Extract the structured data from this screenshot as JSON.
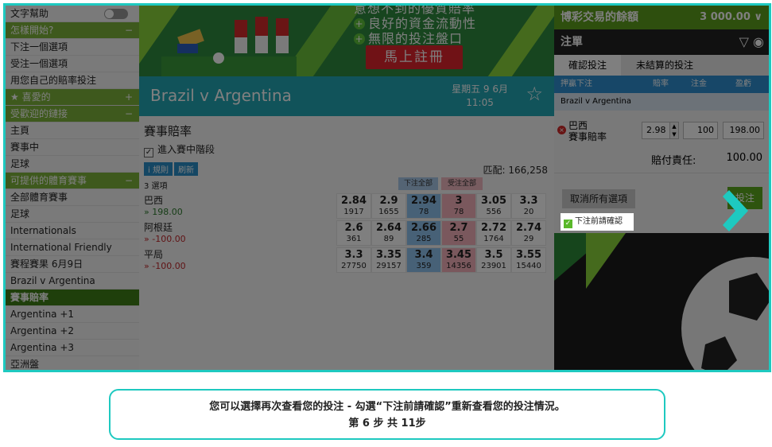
{
  "sidebar": {
    "items": [
      {
        "label": "文字幫助",
        "kind": "toggle"
      },
      {
        "label": "怎樣開始?",
        "kind": "head",
        "sign": "−"
      },
      {
        "label": "下注一個選項",
        "kind": "item"
      },
      {
        "label": "受注一個選項",
        "kind": "item"
      },
      {
        "label": "用您自己的賠率投注",
        "kind": "item"
      },
      {
        "label": "喜愛的",
        "kind": "head",
        "sign": "+",
        "star": true
      },
      {
        "label": "受歡迎的鏈接",
        "kind": "head",
        "sign": "−"
      },
      {
        "label": "主頁",
        "kind": "item"
      },
      {
        "label": "賽事中",
        "kind": "item"
      },
      {
        "label": "足球",
        "kind": "item"
      },
      {
        "label": "可提供的體育賽事",
        "kind": "head",
        "sign": "−"
      },
      {
        "label": "全部體育賽事",
        "kind": "item"
      },
      {
        "label": "足球",
        "kind": "item"
      },
      {
        "label": "Internationals",
        "kind": "item"
      },
      {
        "label": "International Friendly",
        "kind": "item"
      },
      {
        "label": "賽程賽果 6月9日",
        "kind": "item"
      },
      {
        "label": "Brazil v Argentina",
        "kind": "item"
      },
      {
        "label": "賽事賠率",
        "kind": "active"
      },
      {
        "label": "Argentina +1",
        "kind": "item"
      },
      {
        "label": "Argentina +2",
        "kind": "item"
      },
      {
        "label": "Argentina +3",
        "kind": "item"
      },
      {
        "label": "亞洲盤",
        "kind": "item"
      }
    ]
  },
  "banner": {
    "line0": "意想不到的優質賠率",
    "line1": "良好的資金流動性",
    "line2": "無限的投注盤口",
    "register": "馬上註冊"
  },
  "match": {
    "title": "Brazil v Argentina",
    "date": "星期五 9 6月",
    "time": "11:05"
  },
  "market": {
    "title": "賽事賠率",
    "inplay": "進入賽中階段",
    "rules": "規則",
    "refresh": "刷新",
    "matched": "匹配: 166,258",
    "selections": "3 選項",
    "back_all": "下注全部",
    "lay_all": "受注全部",
    "runners": [
      {
        "name": "巴西",
        "pl": "» 198.00",
        "neg": false,
        "odds": [
          [
            "2.84",
            "1917"
          ],
          [
            "2.9",
            "1655"
          ],
          [
            "2.94",
            "78"
          ],
          [
            "3",
            "78"
          ],
          [
            "3.05",
            "556"
          ],
          [
            "3.3",
            "20"
          ]
        ]
      },
      {
        "name": "阿根廷",
        "pl": "» -100.00",
        "neg": true,
        "odds": [
          [
            "2.6",
            "361"
          ],
          [
            "2.64",
            "89"
          ],
          [
            "2.66",
            "285"
          ],
          [
            "2.7",
            "55"
          ],
          [
            "2.72",
            "1764"
          ],
          [
            "2.74",
            "29"
          ]
        ]
      },
      {
        "name": "平局",
        "pl": "» -100.00",
        "neg": true,
        "odds": [
          [
            "3.3",
            "27750"
          ],
          [
            "3.35",
            "29157"
          ],
          [
            "3.4",
            "359"
          ],
          [
            "3.45",
            "14356"
          ],
          [
            "3.5",
            "23901"
          ],
          [
            "3.55",
            "15440"
          ]
        ]
      }
    ]
  },
  "panel": {
    "balance_label": "博彩交易的餘額",
    "balance": "3 000.00",
    "slip_title": "注單",
    "tab_confirm": "確認投注",
    "tab_unmatched": "未結算的投注",
    "col_back": "押贏下注",
    "col_odds": "賠率",
    "col_stake": "注金",
    "col_profit": "盈虧",
    "event": "Brazil v Argentina",
    "bet_name": "巴西",
    "bet_market": "賽事賠率",
    "bet_odds": "2.98",
    "bet_stake": "100",
    "bet_profit": "198.00",
    "liability_label": "賠付責任:",
    "liability": "100.00",
    "cancel_all": "取消所有選項",
    "place": "投注",
    "confirm_before": "下注前請確認"
  },
  "tooltip": {
    "text": "您可以選擇再次查看您的投注 - 勾選“下注前請確認”重新查看您的投注情況。",
    "step_prefix": "第",
    "step": "6",
    "step_mid": "步 共",
    "total": "11",
    "step_suffix": "步"
  },
  "colors": {
    "accent": "#1ec9c0",
    "green": "#5d9e1d",
    "back": "#8ec2ef",
    "lay": "#f5b1bb"
  }
}
